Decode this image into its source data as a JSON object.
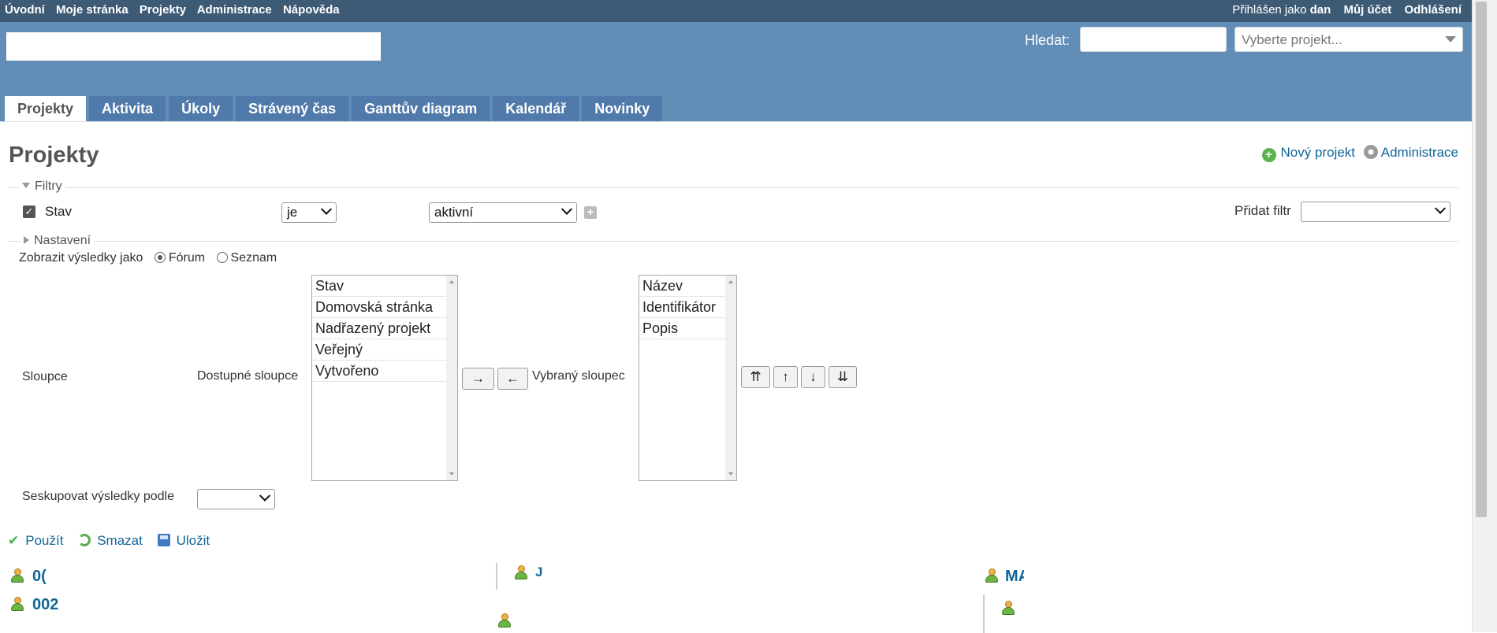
{
  "top_menu": {
    "items": [
      "Úvodní",
      "Moje stránka",
      "Projekty",
      "Administrace",
      "Nápověda"
    ],
    "logged_in_prefix": "Přihlášen jako",
    "user": "dan",
    "account": "Můj účet",
    "logout": "Odhlášení"
  },
  "header": {
    "search_label": "Hledat:",
    "project_jump_placeholder": "Vyberte projekt..."
  },
  "main_menu": {
    "tabs": [
      "Projekty",
      "Aktivita",
      "Úkoly",
      "Strávený čas",
      "Ganttův diagram",
      "Kalendář",
      "Novinky"
    ],
    "selected": "Projekty"
  },
  "page": {
    "title": "Projekty",
    "new_project": "Nový projekt",
    "administration": "Administrace"
  },
  "filters": {
    "legend": "Filtry",
    "status_label": "Stav",
    "operator": "je",
    "value": "aktivní",
    "add_filter_label": "Přidat filtr",
    "add_filter_value": ""
  },
  "options": {
    "legend": "Nastavení",
    "display_as_label": "Zobrazit výsledky jako",
    "display_board": "Fórum",
    "display_list": "Seznam",
    "columns_label": "Sloupce",
    "available_label": "Dostupné sloupce",
    "available_columns": [
      "Stav",
      "Domovská stránka",
      "Nadřazený projekt",
      "Veřejný",
      "Vytvořeno"
    ],
    "selected_label": "Vybraný sloupec",
    "selected_columns": [
      "Název",
      "Identifikátor",
      "Popis"
    ],
    "move_right": "→",
    "move_left": "←",
    "move_top": "⇈",
    "move_up": "↑",
    "move_down": "↓",
    "move_bottom": "⇊",
    "group_by_label": "Seskupovat výsledky podle",
    "group_by_value": ""
  },
  "actions": {
    "apply": "Použít",
    "clear": "Smazat",
    "save": "Uložit"
  },
  "projects": {
    "col1_row1": "0(",
    "col1_row2": "002",
    "col2_row1": "J",
    "col3_row1": "MA"
  },
  "colors": {
    "top_menu_bg": "#3e5b76",
    "header_bg": "#628db6",
    "tab_bg": "#507aaa",
    "link": "#169"
  }
}
